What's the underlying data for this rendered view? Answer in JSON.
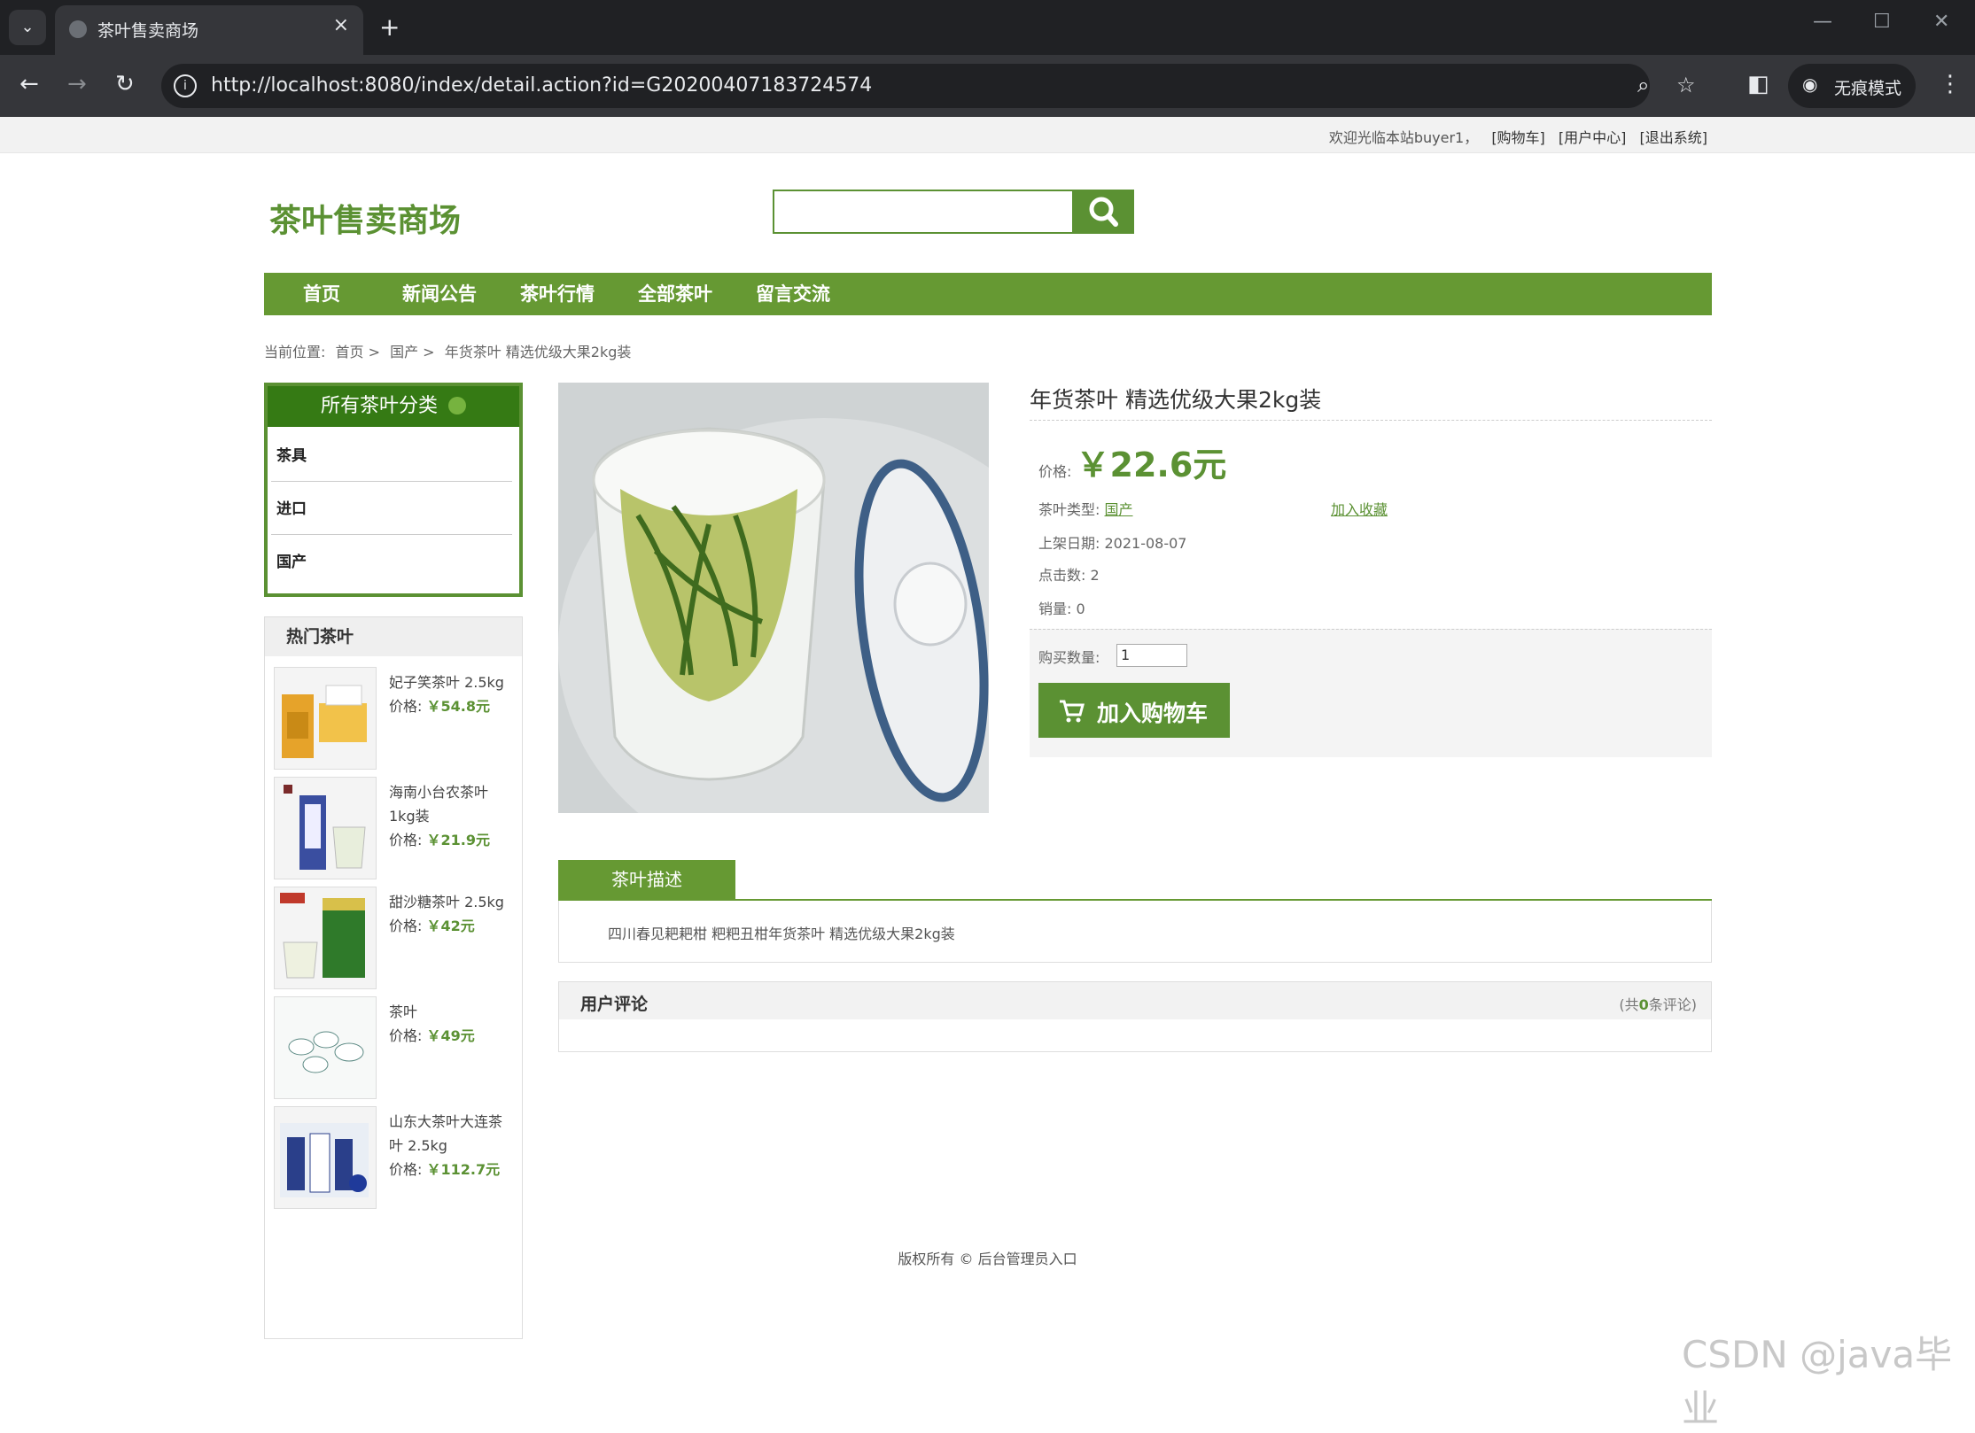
{
  "browser": {
    "tab_title": "茶叶售卖商场",
    "url": "http://localhost:8080/index/detail.action?id=G20200407183724574",
    "incognito_label": "无痕模式"
  },
  "topbar": {
    "welcome": "欢迎光临本站buyer1，",
    "cart": "[购物车]",
    "user_center": "[用户中心]",
    "logout": "[退出系统]"
  },
  "site": {
    "logo": "茶叶售卖商场",
    "search_value": ""
  },
  "nav": [
    "首页",
    "新闻公告",
    "茶叶行情",
    "全部茶叶",
    "留言交流"
  ],
  "breadcrumb": {
    "label": "当前位置:",
    "home": "首页 >",
    "category": "国产 >",
    "current": "年货茶叶 精选优级大果2kg装"
  },
  "categories": {
    "title": "所有茶叶分类",
    "items": [
      "茶具",
      "进口",
      "国产"
    ]
  },
  "hot": {
    "title": "热门茶叶",
    "price_label": "价格:",
    "items": [
      {
        "name": "妃子笑茶叶 2.5kg",
        "price": "￥54.8元"
      },
      {
        "name": "海南小台农茶叶1kg装",
        "price": "￥21.9元"
      },
      {
        "name": "甜沙糖茶叶 2.5kg",
        "price": "￥42元"
      },
      {
        "name": "茶叶",
        "price": "￥49元"
      },
      {
        "name": "山东大茶叶大连茶叶 2.5kg",
        "price": "￥112.7元"
      }
    ]
  },
  "product": {
    "title": "年货茶叶 精选优级大果2kg装",
    "price_label": "价格:",
    "price": "￥22.6元",
    "type_label": "茶叶类型:",
    "type_value": "国产",
    "favorite": "加入收藏",
    "date_label": "上架日期:",
    "date_value": "2021-08-07",
    "clicks_label": "点击数:",
    "clicks_value": "2",
    "sales_label": "销量:",
    "sales_value": "0",
    "qty_label": "购买数量:",
    "qty_value": "1",
    "cart_button": "加入购物车"
  },
  "description": {
    "tab": "茶叶描述",
    "text": "四川春见耙耙柑 粑粑丑柑年货茶叶 精选优级大果2kg装"
  },
  "reviews": {
    "title": "用户评论",
    "count_prefix": "(共",
    "count": "0",
    "count_suffix": "条评论)"
  },
  "footer": "版权所有 © 后台管理员入口",
  "watermark": "CSDN @java毕业"
}
